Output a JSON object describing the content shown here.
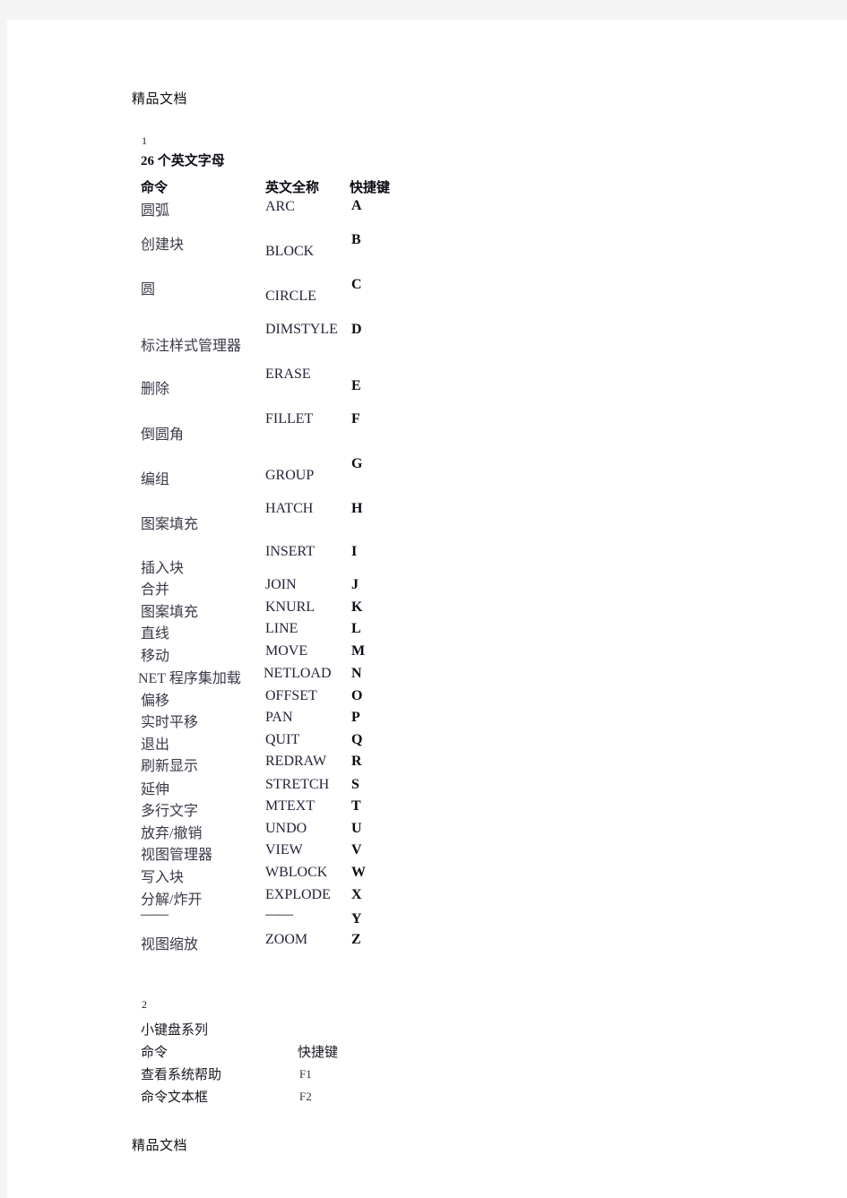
{
  "document": {
    "watermark_top": "精品文档",
    "watermark_bottom": "精品文档"
  },
  "section1": {
    "number": "1",
    "title": "26 个英文字母",
    "headers": {
      "command": "命令",
      "english": "英文全称",
      "shortcut": "快捷键"
    },
    "rows": [
      {
        "command": "圆弧",
        "english": "ARC",
        "key": "A"
      },
      {
        "command": "创建块",
        "english": "BLOCK",
        "key": "B"
      },
      {
        "command": "圆",
        "english": "CIRCLE",
        "key": "C"
      },
      {
        "command": "标注样式管理器",
        "english": "DIMSTYLE",
        "key": "D"
      },
      {
        "command": "删除",
        "english": "ERASE",
        "key": "E"
      },
      {
        "command": "倒圆角",
        "english": "FILLET",
        "key": "F"
      },
      {
        "command": "编组",
        "english": "GROUP",
        "key": "G"
      },
      {
        "command": "图案填充",
        "english": "HATCH",
        "key": "H"
      },
      {
        "command": "插入块",
        "english": "INSERT",
        "key": "I"
      },
      {
        "command": "合并",
        "english": "JOIN",
        "key": "J"
      },
      {
        "command": "图案填充",
        "english": "KNURL",
        "key": "K"
      },
      {
        "command": "直线",
        "english": "LINE",
        "key": "L"
      },
      {
        "command": "移动",
        "english": "MOVE",
        "key": "M"
      },
      {
        "command": "NET 程序集加载",
        "english": "NETLOAD",
        "key": "N"
      },
      {
        "command": "偏移",
        "english": "OFFSET",
        "key": "O"
      },
      {
        "command": "实时平移",
        "english": "PAN",
        "key": "P"
      },
      {
        "command": "退出",
        "english": "QUIT",
        "key": "Q"
      },
      {
        "command": "刷新显示",
        "english": "REDRAW",
        "key": "R"
      },
      {
        "command": "延伸",
        "english": "STRETCH",
        "key": "S"
      },
      {
        "command": "多行文字",
        "english": "MTEXT",
        "key": "T"
      },
      {
        "command": "放弃/撤销",
        "english": "UNDO",
        "key": "U"
      },
      {
        "command": "视图管理器",
        "english": "VIEW",
        "key": "V"
      },
      {
        "command": "写入块",
        "english": "WBLOCK",
        "key": "W"
      },
      {
        "command": "分解/炸开",
        "english": "EXPLODE",
        "key": "X"
      },
      {
        "command": "——",
        "english": "——",
        "key": "Y"
      },
      {
        "command": "视图缩放",
        "english": "ZOOM",
        "key": "Z"
      }
    ]
  },
  "section2": {
    "number": "2",
    "title": "小键盘系列",
    "headers": {
      "command": "命令",
      "shortcut": "快捷键"
    },
    "rows": [
      {
        "command": "查看系统帮助",
        "key": "F1"
      },
      {
        "command": "命令文本框",
        "key": "F2"
      }
    ]
  }
}
